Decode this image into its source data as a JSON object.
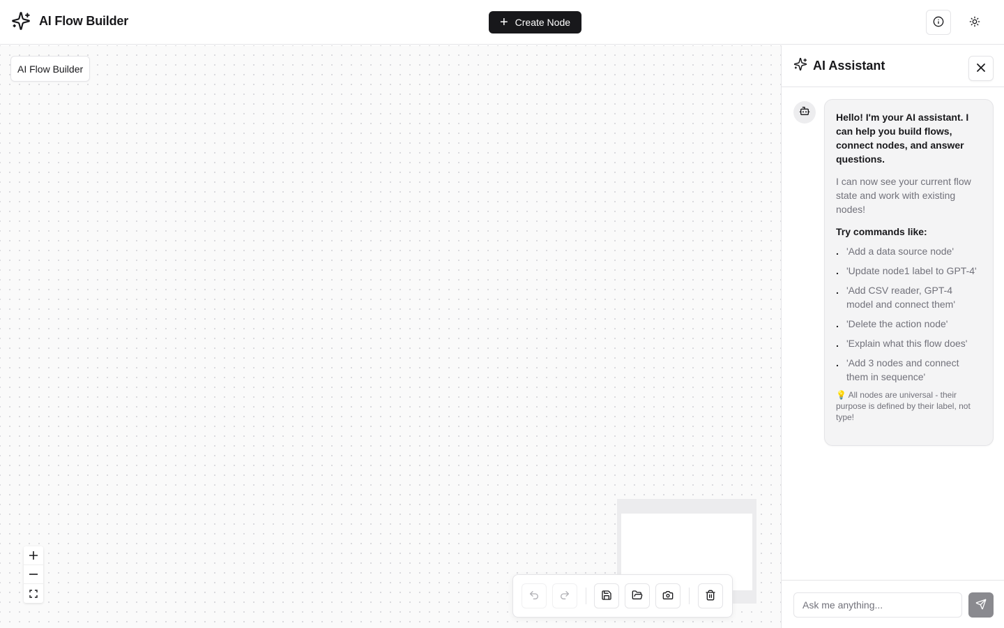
{
  "header": {
    "app_title": "AI Flow Builder",
    "create_node_label": "Create Node",
    "icons": {
      "logo": "sparkles-icon",
      "create": "plus-icon",
      "info": "info-icon",
      "theme": "sun-icon"
    }
  },
  "canvas": {
    "label": "AI Flow Builder",
    "zoom_controls": [
      "zoom-in",
      "zoom-out",
      "fit-view"
    ],
    "toolbar": [
      "undo",
      "redo",
      "save",
      "open",
      "screenshot",
      "delete"
    ]
  },
  "assistant": {
    "title": "AI Assistant",
    "message": {
      "greeting": "Hello! I'm your AI assistant. I can help you build flows, connect nodes, and answer questions.",
      "subtext": "I can now see your current flow state and work with existing nodes!",
      "try_title": "Try commands like:",
      "commands": [
        "'Add a data source node'",
        "'Update node1 label to GPT-4'",
        "'Add CSV reader, GPT-4 model and connect them'",
        "'Delete the action node'",
        "'Explain what this flow does'",
        "'Add 3 nodes and connect them in sequence'"
      ],
      "note": "💡 All nodes are universal - their purpose is defined by their label, not type!"
    },
    "input_value": "",
    "input_placeholder": "Ask me anything..."
  },
  "colors": {
    "primary": "#18181b",
    "border": "#e4e4e7",
    "muted_text": "#71717a",
    "bubble_bg": "#f4f4f5",
    "send_button": "#8a8a8f"
  }
}
